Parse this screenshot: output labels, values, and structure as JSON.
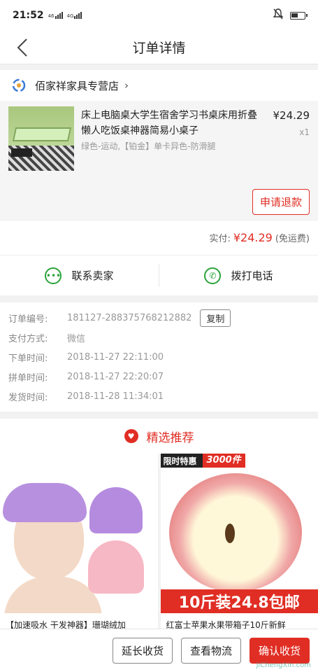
{
  "status": {
    "time": "21:52",
    "net1": "46",
    "net2": "4G"
  },
  "nav": {
    "title": "订单详情"
  },
  "shop": {
    "name": "佰家祥家具专营店"
  },
  "product": {
    "title": "床上电脑桌大学生宿舍学习书桌床用折叠懒人吃饭桌神器简易小桌子",
    "spec": "绿色-运动,【铂金】单卡异色-防滑腿",
    "price": "¥24.29",
    "qty": "x1"
  },
  "refund_label": "申请退款",
  "payment": {
    "label": "实付:",
    "amount": "¥24.29",
    "note": "(免运费)"
  },
  "contact": {
    "seller": "联系卖家",
    "phone": "拨打电话"
  },
  "order_info": {
    "rows": [
      {
        "key": "订单编号:",
        "value": "181127-288375768212882"
      },
      {
        "key": "支付方式:",
        "value": "微信"
      },
      {
        "key": "下单时间:",
        "value": "2018-11-27 22:11:00"
      },
      {
        "key": "拼单时间:",
        "value": "2018-11-27 22:20:07"
      },
      {
        "key": "发货时间:",
        "value": "2018-11-28 11:34:01"
      }
    ],
    "copy_label": "复制"
  },
  "recommend": {
    "title": "精选推荐",
    "items": [
      {
        "title": "【加速吸水 干发神器】珊瑚绒加"
      },
      {
        "title": "红富士苹果水果带箱子10斤新鲜",
        "banner": "限时特惠",
        "badge": "3000件",
        "promo": "10斤装24.8包邮"
      }
    ]
  },
  "actions": {
    "extend": "延长收货",
    "logistics": "查看物流",
    "confirm": "确认收货"
  },
  "watermark": "JiChengXin.com"
}
